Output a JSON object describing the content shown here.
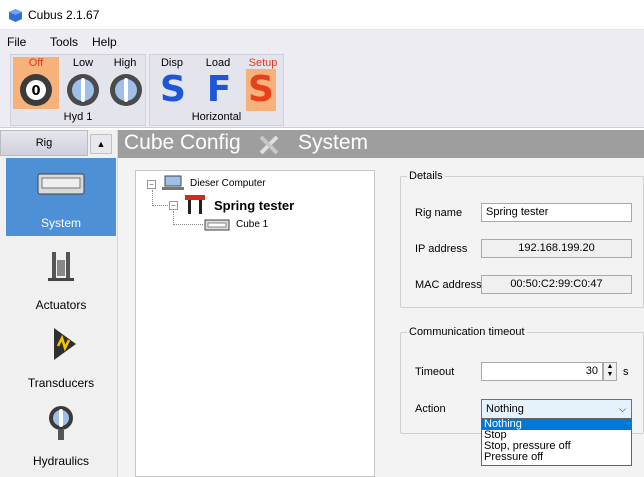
{
  "window": {
    "title": "Cubus 2.1.67",
    "icon": "cube-icon"
  },
  "menu": {
    "file": "File",
    "tools": "Tools",
    "help": "Help"
  },
  "toolbar": {
    "hyd_group": {
      "name": "Hyd 1",
      "off": "Off",
      "low": "Low",
      "high": "High",
      "selected": "Off"
    },
    "horiz_group": {
      "name": "Horizontal",
      "disp": "Disp",
      "load": "Load",
      "setup": "Setup",
      "s1": "S",
      "f": "F",
      "s2": "S",
      "selected": "Setup"
    }
  },
  "nav": {
    "rig_button": "Rig",
    "items": [
      {
        "label": "System",
        "icon": "controller-icon",
        "active": true
      },
      {
        "label": "Actuators",
        "icon": "actuator-icon",
        "active": false
      },
      {
        "label": "Transducers",
        "icon": "transducer-icon",
        "active": false
      },
      {
        "label": "Hydraulics",
        "icon": "hydraulics-icon",
        "active": false
      }
    ]
  },
  "header": {
    "title": "Cube Config",
    "section": "System"
  },
  "tree": {
    "root": "Dieser Computer",
    "rig": "Spring tester",
    "cube": "Cube 1"
  },
  "details": {
    "legend": "Details",
    "rig_name_label": "Rig name",
    "rig_name_value": "Spring tester",
    "ip_label": "IP address",
    "ip_value": "192.168.199.20",
    "mac_label": "MAC address",
    "mac_value": "00:50:C2:99:C0:47"
  },
  "comm": {
    "legend": "Communication timeout",
    "timeout_label": "Timeout",
    "timeout_value": "30",
    "timeout_unit": "s",
    "action_label": "Action",
    "action_value": "Nothing",
    "options": [
      "Nothing",
      "Stop",
      "Stop, pressure off",
      "Pressure off"
    ]
  },
  "colors": {
    "accent": "#4d90d6",
    "selected_tool": "#f6b27a",
    "header_bg": "#9e9e9e",
    "letter_blue": "#1d56d6",
    "letter_red": "#e8401c"
  }
}
